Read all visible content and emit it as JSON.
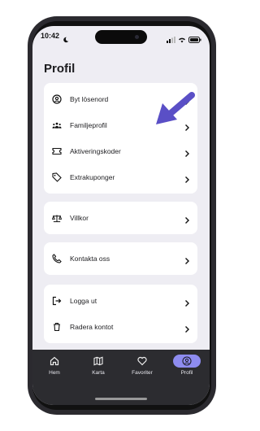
{
  "status_bar": {
    "time": "10:42"
  },
  "header": {
    "title": "Profil"
  },
  "menu": {
    "group1": [
      {
        "label": "Byt lösenord",
        "icon": "user-circle-icon"
      },
      {
        "label": "Familjeprofil",
        "icon": "family-icon"
      },
      {
        "label": "Aktiveringskoder",
        "icon": "ticket-icon"
      },
      {
        "label": "Extrakuponger",
        "icon": "tag-icon"
      }
    ],
    "group2": [
      {
        "label": "Villkor",
        "icon": "scale-icon"
      }
    ],
    "group3": [
      {
        "label": "Kontakta oss",
        "icon": "phone-icon"
      }
    ],
    "group4": [
      {
        "label": "Logga ut",
        "icon": "logout-icon"
      },
      {
        "label": "Radera kontot",
        "icon": "trash-icon"
      }
    ]
  },
  "tabbar": {
    "items": [
      {
        "label": "Hem",
        "icon": "home-icon"
      },
      {
        "label": "Karta",
        "icon": "map-icon"
      },
      {
        "label": "Favoriter",
        "icon": "heart-icon"
      },
      {
        "label": "Profil",
        "icon": "profile-icon",
        "active": true
      }
    ]
  },
  "colors": {
    "accent": "#8e8cf0",
    "annotation_arrow": "#5a4fc6",
    "tabbar_bg": "#2c2c30",
    "screen_bg": "#eeedf3"
  }
}
